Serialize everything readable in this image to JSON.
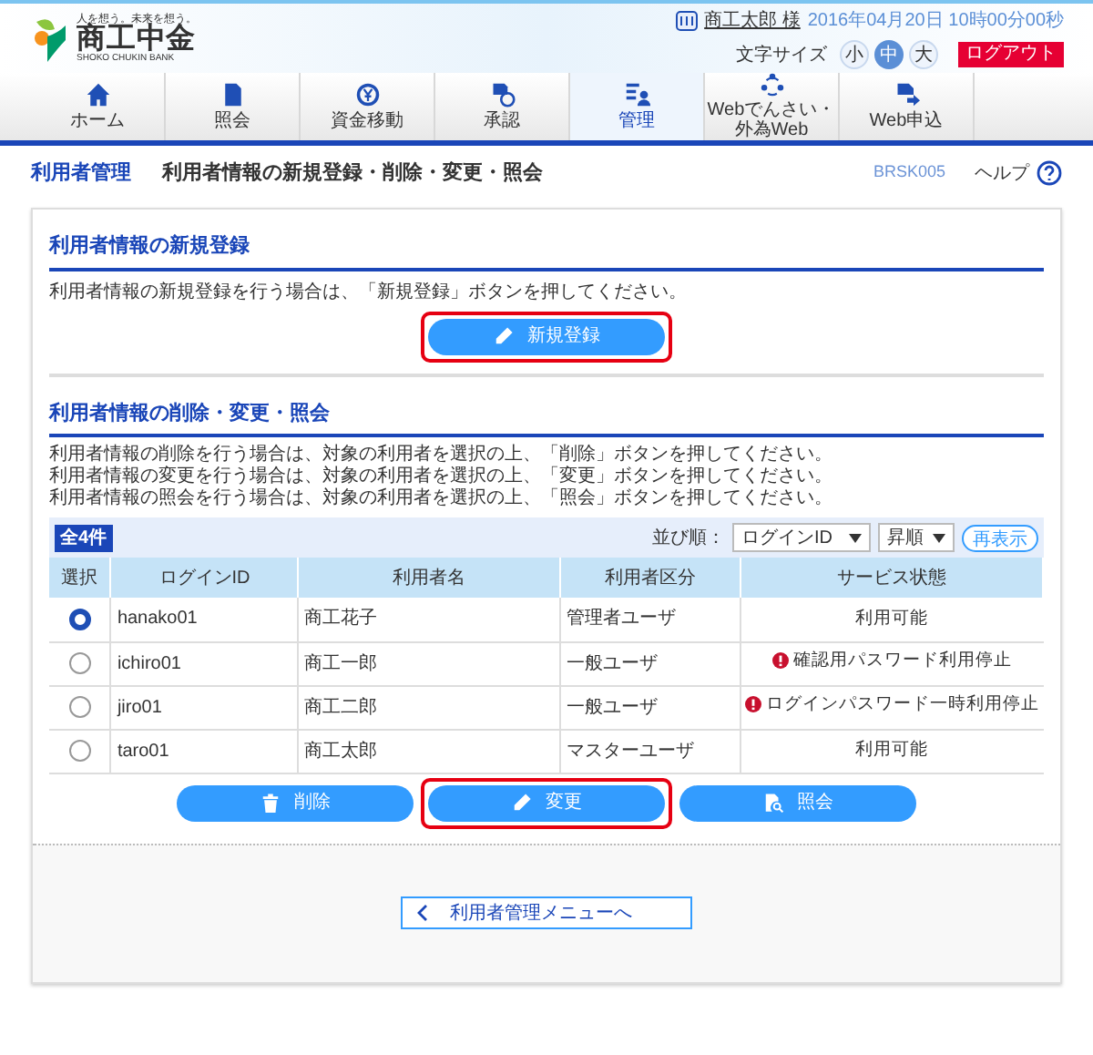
{
  "header": {
    "tagline": "人を想う。未来を想う。",
    "logo_name": "商工中金",
    "logo_sub": "SHOKO CHUKIN BANK",
    "user_name": "商工太郎 様",
    "datetime": "2016年04月20日 10時00分00秒",
    "font_size_label": "文字サイズ",
    "font_sizes": [
      {
        "label": "小",
        "selected": false
      },
      {
        "label": "中",
        "selected": true
      },
      {
        "label": "大",
        "selected": false
      }
    ],
    "logout": "ログアウト"
  },
  "nav": [
    {
      "label": "ホーム",
      "selected": false
    },
    {
      "label": "照会",
      "selected": false
    },
    {
      "label": "資金移動",
      "selected": false
    },
    {
      "label": "承認",
      "selected": false
    },
    {
      "label": "管理",
      "selected": true
    },
    {
      "label": "Webでんさい・外為Web",
      "selected": false
    },
    {
      "label": "Web申込",
      "selected": false
    }
  ],
  "page": {
    "section": "利用者管理",
    "title": "利用者情報の新規登録・削除・変更・照会",
    "code": "BRSK005",
    "help": "ヘルプ"
  },
  "register": {
    "heading": "利用者情報の新規登録",
    "description": "利用者情報の新規登録を行う場合は、「新規登録」ボタンを押してください。",
    "button": {
      "label": "新規登録",
      "highlighted": true
    }
  },
  "manage": {
    "heading": "利用者情報の削除・変更・照会",
    "descriptions": [
      "利用者情報の削除を行う場合は、対象の利用者を選択の上、「削除」ボタンを押してください。",
      "利用者情報の変更を行う場合は、対象の利用者を選択の上、「変更」ボタンを押してください。",
      "利用者情報の照会を行う場合は、対象の利用者を選択の上、「照会」ボタンを押してください。"
    ],
    "count": "全4件",
    "sort_label": "並び順：",
    "sort_field": "ログインID",
    "sort_order": "昇順",
    "refresh": "再表示",
    "columns": [
      "選択",
      "ログインID",
      "利用者名",
      "利用者区分",
      "サービス状態"
    ],
    "rows": [
      {
        "selected": true,
        "login_id": "hanako01",
        "name": "商工花子",
        "type": "管理者ユーザ",
        "status": "利用可能",
        "warning": false
      },
      {
        "selected": false,
        "login_id": "ichiro01",
        "name": "商工一郎",
        "type": "一般ユーザ",
        "status": "確認用パスワード利用停止",
        "warning": true
      },
      {
        "selected": false,
        "login_id": "jiro01",
        "name": "商工二郎",
        "type": "一般ユーザ",
        "status": "ログインパスワード一時利用停止",
        "warning": true
      },
      {
        "selected": false,
        "login_id": "taro01",
        "name": "商工太郎",
        "type": "マスターユーザ",
        "status": "利用可能",
        "warning": false
      }
    ],
    "buttons": [
      {
        "label": "削除",
        "highlighted": false
      },
      {
        "label": "変更",
        "highlighted": true
      },
      {
        "label": "照会",
        "highlighted": false
      }
    ]
  },
  "footer": {
    "back": "利用者管理メニューへ"
  }
}
